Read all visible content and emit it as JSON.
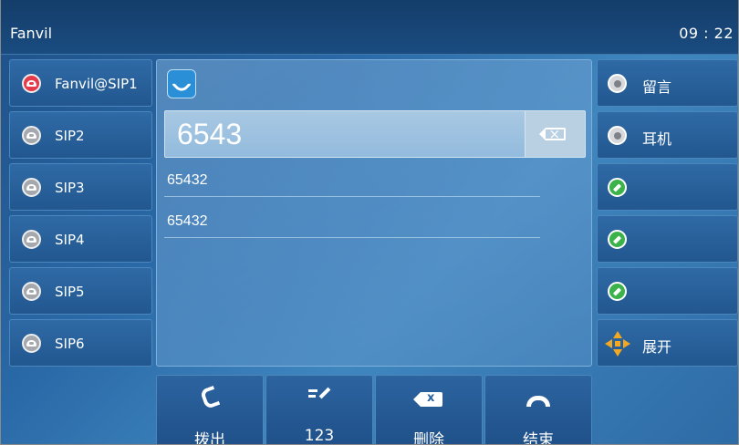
{
  "topbar": {
    "title": "Fanvil",
    "time": "09 : 22"
  },
  "lines": [
    {
      "label": "Fanvil@SIP1",
      "status": "active",
      "color": "#e43a4a",
      "icon": "phone-red-icon"
    },
    {
      "label": "SIP2",
      "status": "idle",
      "color": "#a5a8ad",
      "icon": "phone-grey-icon"
    },
    {
      "label": "SIP3",
      "status": "idle",
      "color": "#a5a8ad",
      "icon": "phone-grey-icon"
    },
    {
      "label": "SIP4",
      "status": "idle",
      "color": "#a5a8ad",
      "icon": "phone-grey-icon"
    },
    {
      "label": "SIP5",
      "status": "idle",
      "color": "#a5a8ad",
      "icon": "phone-grey-icon"
    },
    {
      "label": "SIP6",
      "status": "idle",
      "color": "#a5a8ad",
      "icon": "phone-grey-icon"
    }
  ],
  "dialer": {
    "app_icon": "call-app-icon",
    "input_value": "6543",
    "clear_icon": "backspace-icon",
    "suggestions": [
      "65432",
      "65432"
    ]
  },
  "right_keys": [
    {
      "label": "留言",
      "icon": "record-icon"
    },
    {
      "label": "耳机",
      "icon": "record-icon"
    },
    {
      "label": "",
      "icon": "edit-icon"
    },
    {
      "label": "",
      "icon": "edit-icon"
    },
    {
      "label": "",
      "icon": "edit-icon"
    },
    {
      "label": "展开",
      "icon": "expand-icon"
    }
  ],
  "softkeys": [
    {
      "label": "拨出",
      "icon": "dial-icon"
    },
    {
      "label": "123",
      "icon": "input-mode-icon"
    },
    {
      "label": "删除",
      "icon": "delete-icon"
    },
    {
      "label": "结束",
      "icon": "hangup-icon"
    }
  ],
  "colors": {
    "accent": "#2b8fd8",
    "edit_green": "#3bb34a",
    "expand_orange": "#f2a820",
    "background": "#2a6aa8"
  }
}
